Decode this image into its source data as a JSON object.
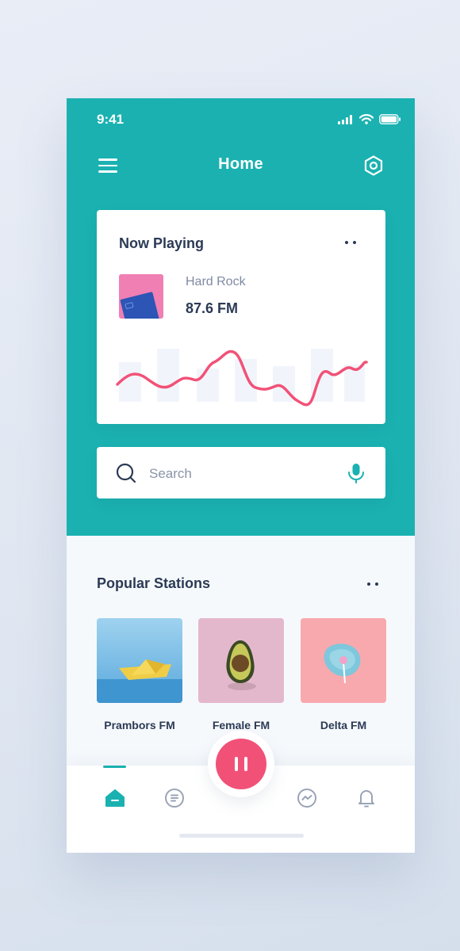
{
  "status": {
    "time": "9:41"
  },
  "header": {
    "title": "Home"
  },
  "now_playing": {
    "title": "Now Playing",
    "genre": "Hard Rock",
    "frequency": "87.6 FM"
  },
  "search": {
    "placeholder": "Search"
  },
  "popular": {
    "title": "Popular Stations",
    "stations": [
      {
        "label": "Prambors FM"
      },
      {
        "label": "Female FM"
      },
      {
        "label": "Delta FM"
      }
    ]
  },
  "colors": {
    "primary": "#1bb1b1",
    "accent": "#f25177",
    "text": "#2b3a55"
  },
  "icons": [
    "hamburger-menu-icon",
    "settings-icon",
    "search-icon",
    "microphone-icon",
    "home-icon",
    "list-icon",
    "messenger-icon",
    "bell-icon",
    "pause-icon"
  ]
}
